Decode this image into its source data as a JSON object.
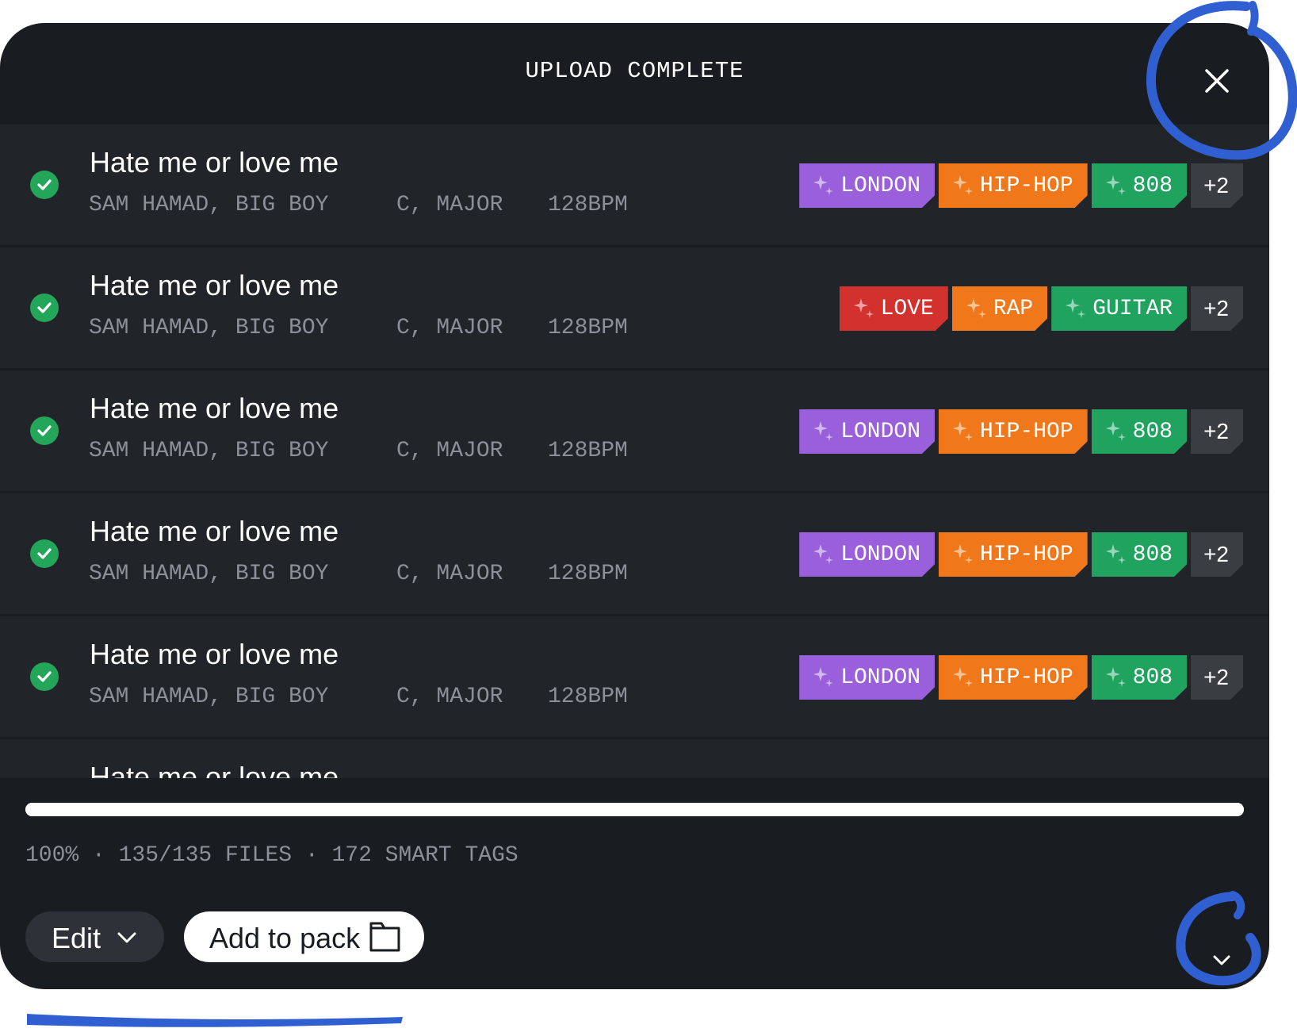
{
  "header": {
    "title": "UPLOAD COMPLETE",
    "close_icon": "close-icon"
  },
  "colors": {
    "panel": "#191c20",
    "row": "#212429",
    "check": "#23a55a",
    "tag_purple": "#9a5fdb",
    "tag_orange": "#f0781a",
    "tag_green": "#1fa35f",
    "tag_red": "#d3312e",
    "tag_more": "#3a3d42",
    "annotation_blue": "#2f5fd0"
  },
  "files": [
    {
      "name": "Hate me or love me",
      "artists": "SAM HAMAD, BIG BOY",
      "key": "C, MAJOR",
      "bpm": "128BPM",
      "tags": [
        {
          "label": "LONDON",
          "color": "#9a5fdb"
        },
        {
          "label": "HIP-HOP",
          "color": "#f0781a"
        },
        {
          "label": "808",
          "color": "#1fa35f"
        }
      ],
      "more": "+2"
    },
    {
      "name": "Hate me or love me",
      "artists": "SAM HAMAD, BIG BOY",
      "key": "C, MAJOR",
      "bpm": "128BPM",
      "tags": [
        {
          "label": "LOVE",
          "color": "#d3312e"
        },
        {
          "label": "RAP",
          "color": "#f0781a"
        },
        {
          "label": "GUITAR",
          "color": "#1fa35f"
        }
      ],
      "more": "+2"
    },
    {
      "name": "Hate me or love me",
      "artists": "SAM HAMAD, BIG BOY",
      "key": "C, MAJOR",
      "bpm": "128BPM",
      "tags": [
        {
          "label": "LONDON",
          "color": "#9a5fdb"
        },
        {
          "label": "HIP-HOP",
          "color": "#f0781a"
        },
        {
          "label": "808",
          "color": "#1fa35f"
        }
      ],
      "more": "+2"
    },
    {
      "name": "Hate me or love me",
      "artists": "SAM HAMAD, BIG BOY",
      "key": "C, MAJOR",
      "bpm": "128BPM",
      "tags": [
        {
          "label": "LONDON",
          "color": "#9a5fdb"
        },
        {
          "label": "HIP-HOP",
          "color": "#f0781a"
        },
        {
          "label": "808",
          "color": "#1fa35f"
        }
      ],
      "more": "+2"
    },
    {
      "name": "Hate me or love me",
      "artists": "SAM HAMAD, BIG BOY",
      "key": "C, MAJOR",
      "bpm": "128BPM",
      "tags": [
        {
          "label": "LONDON",
          "color": "#9a5fdb"
        },
        {
          "label": "HIP-HOP",
          "color": "#f0781a"
        },
        {
          "label": "808",
          "color": "#1fa35f"
        }
      ],
      "more": "+2"
    },
    {
      "name": "Hate me or love me",
      "artists": "",
      "key": "",
      "bpm": "",
      "tags": [],
      "more": ""
    }
  ],
  "progress": {
    "percent": 100
  },
  "status": {
    "text": "100% · 135/135 FILES · 172 SMART TAGS"
  },
  "footer": {
    "edit_label": "Edit",
    "edit_icon": "chevron-down-icon",
    "add_to_pack_label": "Add to pack",
    "add_to_pack_icon": "folder-icon",
    "expand_icon": "chevron-down-icon"
  }
}
